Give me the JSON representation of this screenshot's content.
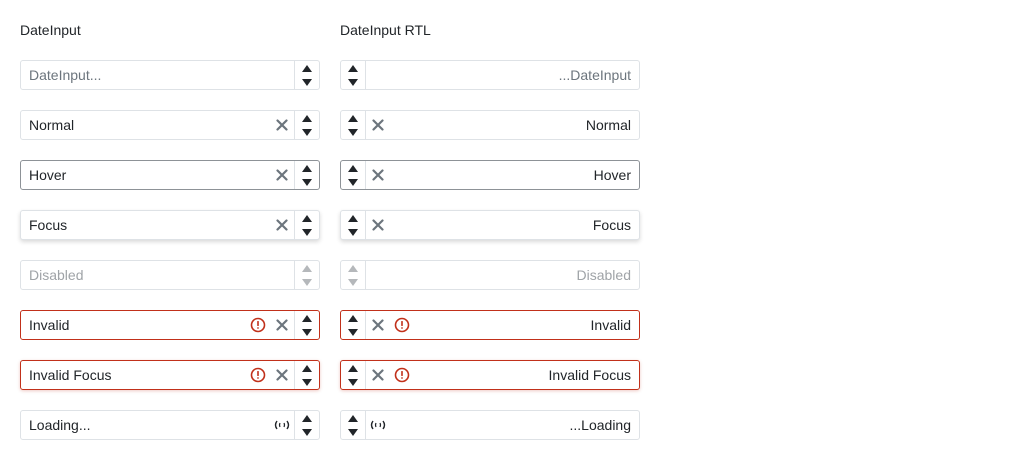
{
  "columns": {
    "ltr_title": "DateInput",
    "rtl_title": "DateInput RTL"
  },
  "rows": {
    "placeholder": {
      "ltr": "DateInput...",
      "rtl": "...DateInput"
    },
    "normal": {
      "ltr": "Normal",
      "rtl": "Normal"
    },
    "hover": {
      "ltr": "Hover",
      "rtl": "Hover"
    },
    "focus": {
      "ltr": "Focus",
      "rtl": "Focus"
    },
    "disabled": {
      "ltr": "Disabled",
      "rtl": "Disabled"
    },
    "invalid": {
      "ltr": "Invalid",
      "rtl": "Invalid"
    },
    "invalid_focus": {
      "ltr": "Invalid Focus",
      "rtl": "Invalid Focus"
    },
    "loading": {
      "ltr": "Loading...",
      "rtl": "...Loading"
    }
  },
  "icons": {
    "clear": "close-icon",
    "invalid": "exclamation-circle-icon",
    "loading": "loading-icon",
    "increase": "caret-up-icon",
    "decrease": "caret-down-icon"
  },
  "colors": {
    "border": "#dee2e6",
    "hover_border": "#8d9297",
    "invalid": "#c1301a",
    "text": "#212529",
    "placeholder": "#6c757d"
  }
}
